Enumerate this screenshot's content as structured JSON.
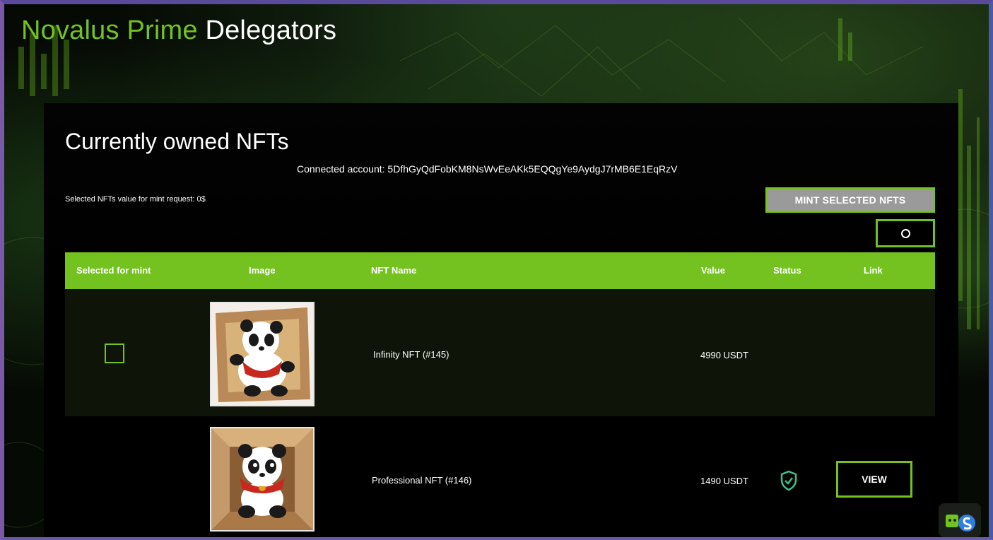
{
  "brand": {
    "part1": "Novalus Prime",
    "part2": "Delegators"
  },
  "colors": {
    "accent": "#74c21f",
    "panel": "#000000",
    "row_highlight": "#0e1508"
  },
  "page": {
    "title": "Currently owned NFTs",
    "connected_account": "Connected account: 5DfhGyQdFobKM8NsWvEeAKk5EQQgYe9AydgJ7rMB6E1EqRzV",
    "selected_value": "Selected NFTs value for mint request: 0$",
    "mint_button": "MINT SELECTED NFTS",
    "refresh_icon": "refresh-icon"
  },
  "table": {
    "headers": [
      "Selected for mint",
      "Image",
      "NFT Name",
      "Value",
      "Status",
      "Link"
    ],
    "rows": [
      {
        "name": "Infinity NFT (#145)",
        "value": "4990 USDT",
        "selected": false,
        "status_icon": "",
        "link_label": ""
      },
      {
        "name": "Professional NFT (#146)",
        "value": "1490 USDT",
        "status_icon": "shield-check-icon",
        "link_label": "VIEW"
      }
    ]
  },
  "widget": {
    "icon": "assistant-widget-icon"
  }
}
